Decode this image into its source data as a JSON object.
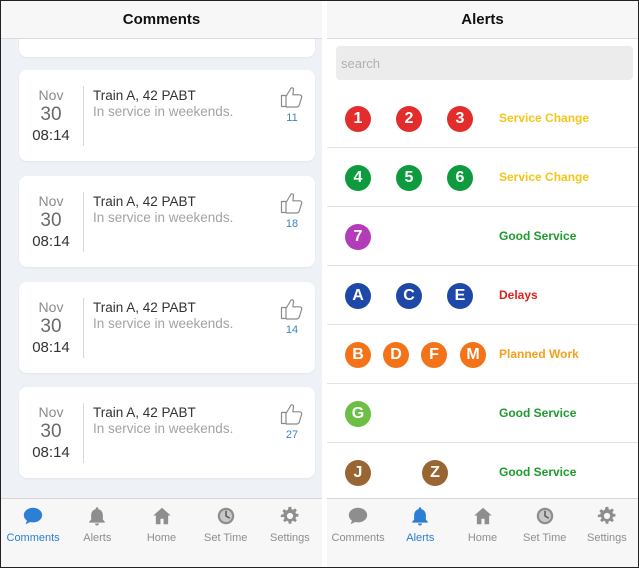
{
  "comments_screen": {
    "title": "Comments",
    "items": [
      {
        "month": "Nov",
        "day": "30",
        "time": "08:14",
        "title": "Train A, 42 PABT",
        "body": "In service in weekends.",
        "likes": "11"
      },
      {
        "month": "Nov",
        "day": "30",
        "time": "08:14",
        "title": "Train A, 42 PABT",
        "body": "In service in weekends.",
        "likes": "18"
      },
      {
        "month": "Nov",
        "day": "30",
        "time": "08:14",
        "title": "Train A, 42 PABT",
        "body": "In service in weekends.",
        "likes": "14"
      },
      {
        "month": "Nov",
        "day": "30",
        "time": "08:14",
        "title": "Train A, 42 PABT",
        "body": "In service in weekends.",
        "likes": "27"
      }
    ]
  },
  "alerts_screen": {
    "title": "Alerts",
    "search_placeholder": "search",
    "lines": [
      {
        "routes": [
          {
            "label": "1",
            "color": "#e32d2d"
          },
          {
            "label": "2",
            "color": "#e32d2d"
          },
          {
            "label": "3",
            "color": "#e32d2d"
          }
        ],
        "status": "Service Change",
        "status_color": "#f5c518"
      },
      {
        "routes": [
          {
            "label": "4",
            "color": "#0e9a3e"
          },
          {
            "label": "5",
            "color": "#0e9a3e"
          },
          {
            "label": "6",
            "color": "#0e9a3e"
          }
        ],
        "status": "Service Change",
        "status_color": "#f5c518"
      },
      {
        "routes": [
          {
            "label": "7",
            "color": "#b33cb8"
          }
        ],
        "status": "Good Service",
        "status_color": "#1e9a2e"
      },
      {
        "routes": [
          {
            "label": "A",
            "color": "#1e48a8"
          },
          {
            "label": "C",
            "color": "#1e48a8"
          },
          {
            "label": "E",
            "color": "#1e48a8"
          }
        ],
        "status": "Delays",
        "status_color": "#e01f1f"
      },
      {
        "routes": [
          {
            "label": "B",
            "color": "#f47318"
          },
          {
            "label": "D",
            "color": "#f47318"
          },
          {
            "label": "F",
            "color": "#f47318"
          },
          {
            "label": "M",
            "color": "#f47318"
          }
        ],
        "status": "Planned Work",
        "status_color": "#f7a01c"
      },
      {
        "routes": [
          {
            "label": "G",
            "color": "#6cbe45"
          }
        ],
        "status": "Good Service",
        "status_color": "#1e9a2e"
      },
      {
        "routes": [
          {
            "label": "J",
            "color": "#996633"
          },
          {
            "label": "Z",
            "color": "#996633"
          }
        ],
        "status": "Good Service",
        "status_color": "#1e9a2e"
      }
    ]
  },
  "tabbar": {
    "tabs": [
      {
        "label": "Comments",
        "icon": "chat-bubble-icon"
      },
      {
        "label": "Alerts",
        "icon": "bell-icon"
      },
      {
        "label": "Home",
        "icon": "home-icon"
      },
      {
        "label": "Set Time",
        "icon": "clock-icon"
      },
      {
        "label": "Settings",
        "icon": "gear-icon"
      }
    ],
    "active_color": "#2c7fd4",
    "inactive_color": "#8e8e8e"
  }
}
